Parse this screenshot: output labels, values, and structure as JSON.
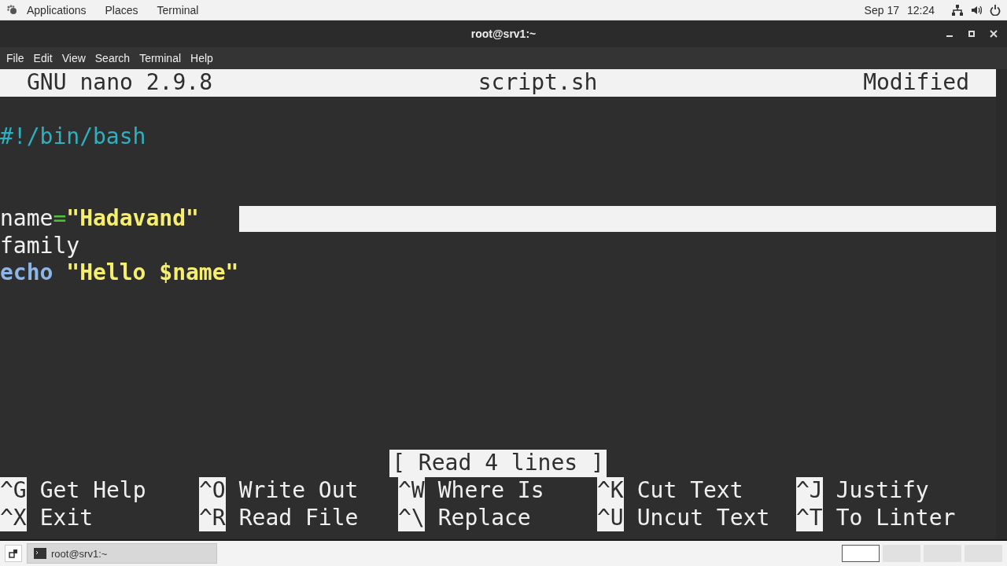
{
  "top_bar": {
    "menus": [
      "Applications",
      "Places",
      "Terminal"
    ],
    "date": "Sep 17",
    "time": "12:24"
  },
  "window": {
    "title": "root@srv1:~",
    "menus": [
      "File",
      "Edit",
      "View",
      "Search",
      "Terminal",
      "Help"
    ]
  },
  "nano": {
    "version": "GNU nano 2.9.8",
    "filename": "script.sh",
    "status": "Modified",
    "lines": [
      {
        "kind": "code",
        "tokens": [
          {
            "text": "#!/bin/bash",
            "kind": "comment"
          }
        ]
      },
      {
        "kind": "blank"
      },
      {
        "kind": "blank"
      },
      {
        "kind": "code",
        "selection_after": true,
        "tokens": [
          {
            "text": "name",
            "kind": "plain"
          },
          {
            "text": "=",
            "kind": "operator"
          },
          {
            "text": "\"Hadavand\"",
            "kind": "string"
          }
        ]
      },
      {
        "kind": "code",
        "tokens": [
          {
            "text": "family",
            "kind": "plain"
          }
        ]
      },
      {
        "kind": "code",
        "tokens": [
          {
            "text": "echo",
            "kind": "builtin"
          },
          {
            "text": "\"Hello $name\"",
            "kind": "string",
            "space_before": true
          }
        ]
      }
    ],
    "message": "[ Read 4 lines ]",
    "shortcuts": [
      {
        "key": "^G",
        "label": "Get Help"
      },
      {
        "key": "^O",
        "label": "Write Out"
      },
      {
        "key": "^W",
        "label": "Where Is"
      },
      {
        "key": "^K",
        "label": "Cut Text"
      },
      {
        "key": "^J",
        "label": "Justify"
      },
      {
        "key": "^X",
        "label": "Exit"
      },
      {
        "key": "^R",
        "label": "Read File"
      },
      {
        "key": "^\\",
        "label": "Replace"
      },
      {
        "key": "^U",
        "label": "Uncut Text"
      },
      {
        "key": "^T",
        "label": "To Linter"
      }
    ]
  },
  "taskbar": {
    "tasks": [
      {
        "label": "root@srv1:~",
        "selected": false
      }
    ],
    "workspaces": [
      {
        "selected": true
      },
      {
        "selected": false
      },
      {
        "selected": false
      },
      {
        "selected": false
      }
    ]
  }
}
